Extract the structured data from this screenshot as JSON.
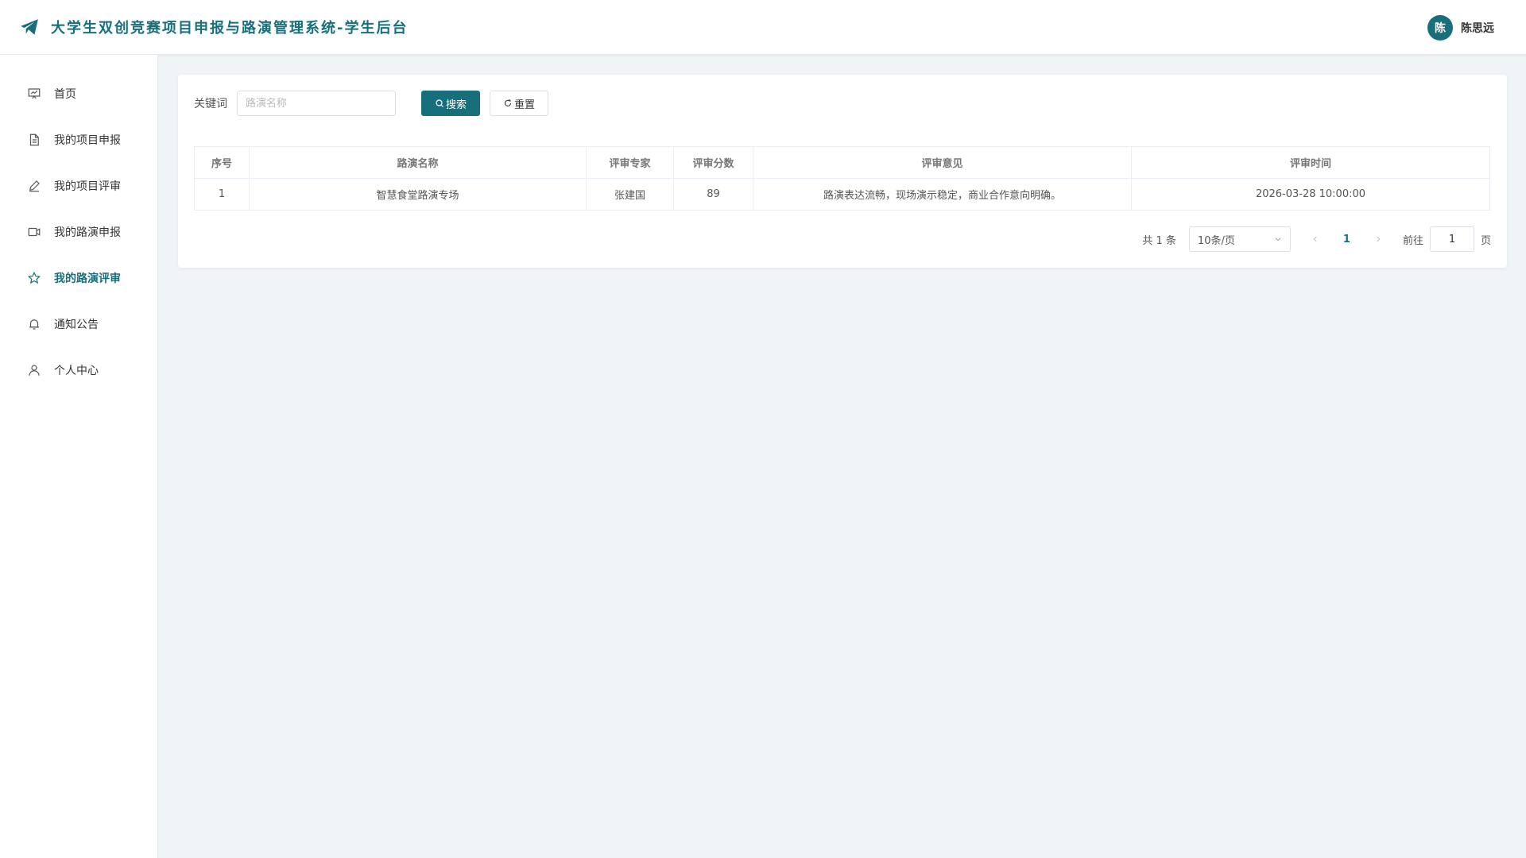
{
  "header": {
    "title": "大学生双创竞赛项目申报与路演管理系统-学生后台",
    "avatar_text": "陈",
    "user_name": "陈思远",
    "brand_color": "#186f7c"
  },
  "sidebar": {
    "items": [
      {
        "label": "首页",
        "icon": "presentation-icon",
        "active": false
      },
      {
        "label": "我的项目申报",
        "icon": "document-icon",
        "active": false
      },
      {
        "label": "我的项目评审",
        "icon": "pen-icon",
        "active": false
      },
      {
        "label": "我的路演申报",
        "icon": "video-camera-icon",
        "active": false
      },
      {
        "label": "我的路演评审",
        "icon": "star-icon",
        "active": true
      },
      {
        "label": "通知公告",
        "icon": "bell-icon",
        "active": false
      },
      {
        "label": "个人中心",
        "icon": "user-icon",
        "active": false
      }
    ]
  },
  "search": {
    "label": "关键词",
    "placeholder": "路演名称",
    "value": "",
    "search_button": "搜索",
    "reset_button": "重置"
  },
  "table": {
    "headers": [
      "序号",
      "路演名称",
      "评审专家",
      "评审分数",
      "评审意见",
      "评审时间"
    ],
    "rows": [
      [
        "1",
        "智慧食堂路演专场",
        "张建国",
        "89",
        "路演表达流畅，现场演示稳定，商业合作意向明确。",
        "2026-03-28 10:00:00"
      ]
    ]
  },
  "pagination": {
    "total_text": "共 1 条",
    "page_size": "10条/页",
    "current_page": "1",
    "goto_label": "前往",
    "goto_value": "1",
    "page_suffix": "页"
  }
}
